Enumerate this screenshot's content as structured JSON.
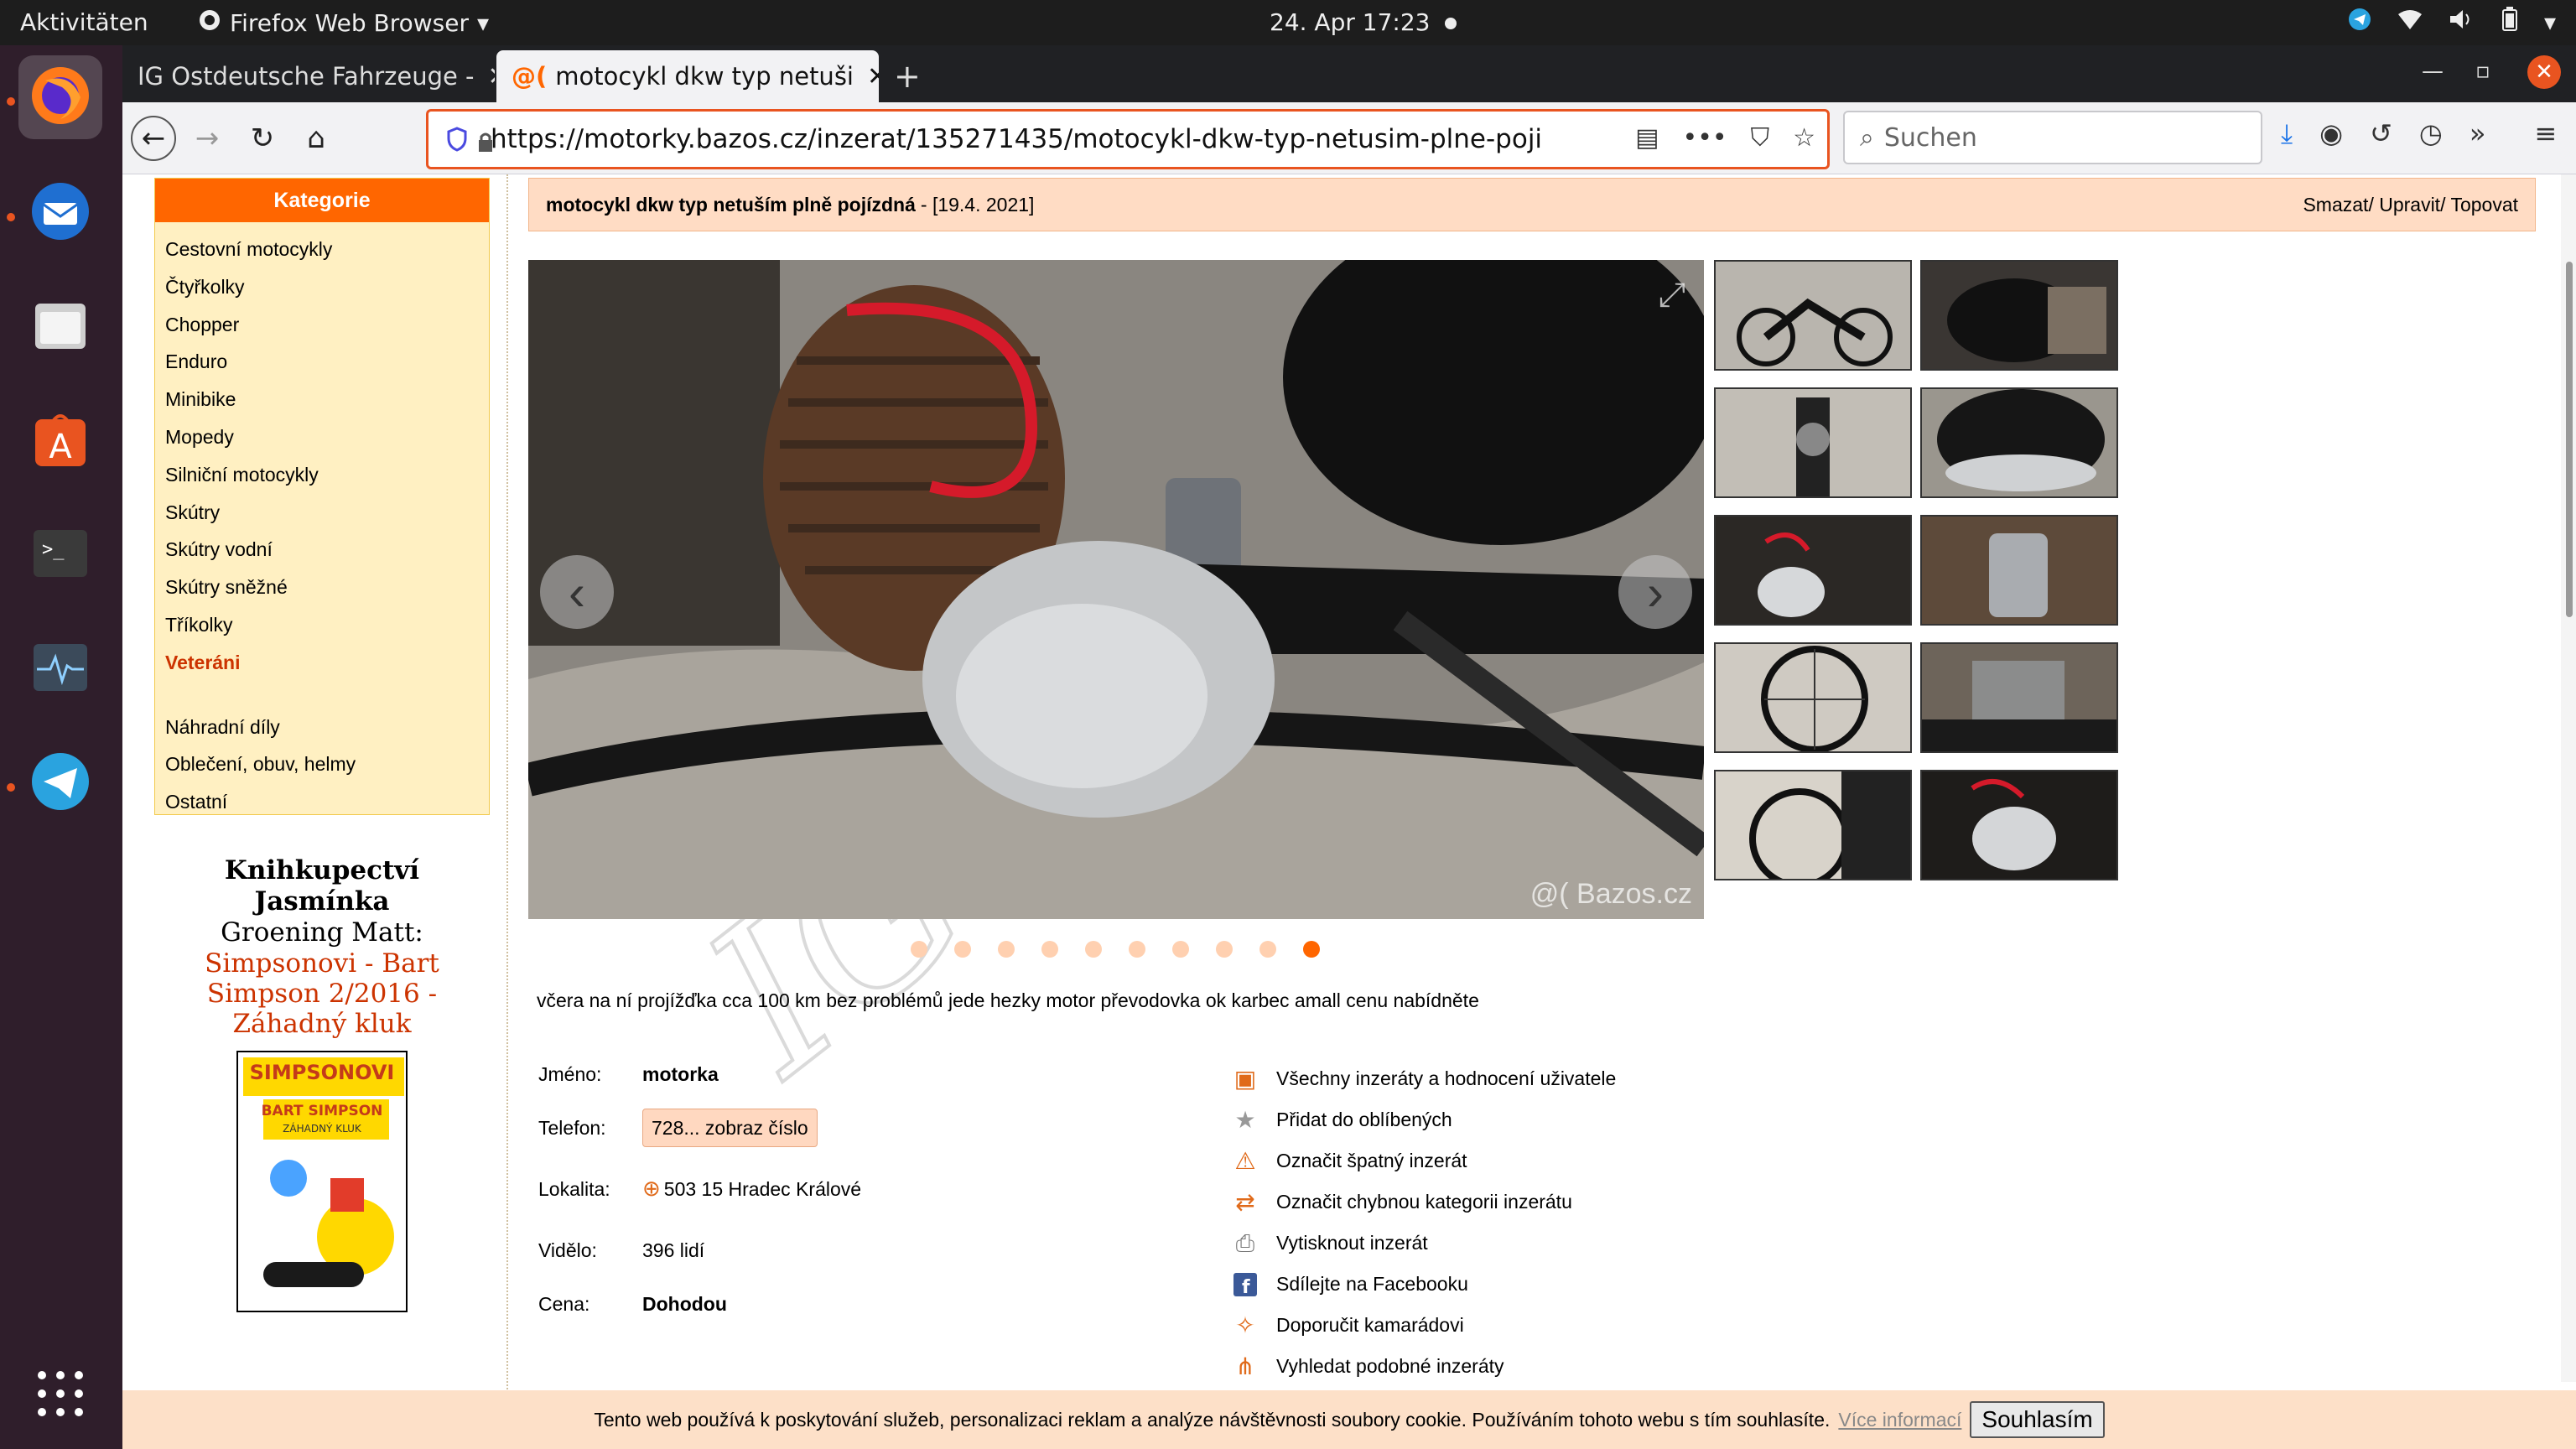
{
  "topbar": {
    "activities": "Aktivitäten",
    "app_name": "Firefox Web Browser",
    "clock": "24. Apr  17:23"
  },
  "tabs": [
    {
      "label": "IG Ostdeutsche Fahrzeuge -"
    },
    {
      "label": "motocykl dkw typ netuši"
    }
  ],
  "nav": {
    "url": "https://motorky.bazos.cz/inzerat/135271435/motocykl-dkw-typ-netusim-plne-poji",
    "search_placeholder": "Suchen"
  },
  "sidebar": {
    "header": "Kategorie",
    "items": [
      "Cestovní motocykly",
      "Čtyřkolky",
      "Chopper",
      "Enduro",
      "Minibike",
      "Mopedy",
      "Silniční motocykly",
      "Skútry",
      "Skútry vodní",
      "Skútry sněžné",
      "Tříkolky",
      "Veteráni"
    ],
    "items2": [
      "Náhradní díly",
      "Oblečení, obuv, helmy",
      "Ostatní"
    ]
  },
  "book": {
    "line1": "Knihkupectví",
    "line2": "Jasmínka",
    "line3": "Groening Matt:",
    "line4": "Simpsonovi - Bart",
    "line5": "Simpson 2/2016 -",
    "line6": "Záhadný kluk",
    "cover_title": "SIMPSONOVI",
    "cover_sub": "BART SIMPSON",
    "cover_sub2": "ZÁHADNÝ KLUK"
  },
  "ad": {
    "title": "motocykl dkw typ netuším plně pojízdná",
    "date": "- [19.4. 2021]",
    "actions_text": "Smazat/ Upravit/ Topovat",
    "watermark": "@( Bazos.cz",
    "description": "včera na ní projížďka cca 100 km bez problémů jede hezky motor převodovka ok karbec amall cenu nabídněte",
    "name_label": "Jméno:",
    "name_value": "motorka",
    "phone_label": "Telefon:",
    "phone_value": "728... zobraz číslo",
    "location_label": "Lokalita:",
    "location_value": "503 15 Hradec Králové",
    "views_label": "Vidělo:",
    "views_value": "396 lidí",
    "price_label": "Cena:",
    "price_value": "Dohodou"
  },
  "carousel": {
    "total": 10,
    "active": 10
  },
  "actions": [
    {
      "label": "Všechny inzeráty a hodnocení uživatele",
      "icon": "user-ads-icon"
    },
    {
      "label": "Přidat do oblíbených",
      "icon": "star-icon"
    },
    {
      "label": "Označit špatný inzerát",
      "icon": "warning-icon"
    },
    {
      "label": "Označit chybnou kategorii inzerátu",
      "icon": "arrows-icon"
    },
    {
      "label": "Vytisknout inzerát",
      "icon": "printer-icon"
    },
    {
      "label": "Sdílejte na Facebooku",
      "icon": "facebook-icon"
    },
    {
      "label": "Doporučit kamarádovi",
      "icon": "recommend-icon"
    },
    {
      "label": "Vyhledat podobné inzeráty",
      "icon": "similar-icon"
    }
  ],
  "cookie": {
    "text": "Tento web používá k poskytování služeb, personalizaci reklam a analýze návštěvnosti soubory cookie. Používáním tohoto webu s tím souhlasíte.",
    "more": "Více informací",
    "accept": "Souhlasím"
  },
  "page_watermark": "IG Ostdeutsche Fahrzeuge",
  "colors": {
    "accent": "#ff6600",
    "highlight": "#cc3300",
    "title_bg": "#ffdcc4",
    "sidebar_bg": "#fff0c2"
  }
}
